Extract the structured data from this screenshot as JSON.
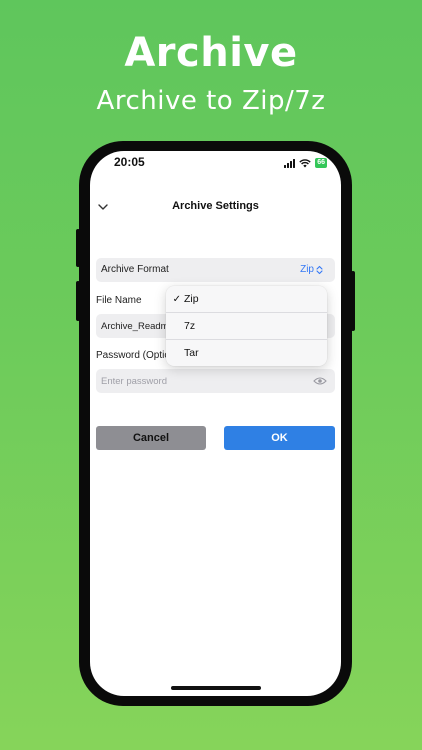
{
  "promo": {
    "title": "Archive",
    "subtitle": "Archive to Zip/7z"
  },
  "status_bar": {
    "time": "20:05",
    "battery": "66"
  },
  "nav": {
    "title": "Archive Settings",
    "back_icon": "chevron-down-icon"
  },
  "form": {
    "format": {
      "label": "Archive Format",
      "value": "Zip"
    },
    "file_name": {
      "label": "File Name",
      "value": "Archive_Readme"
    },
    "password": {
      "label": "Password (Optional)",
      "placeholder": "Enter password",
      "icon": "eye-icon"
    }
  },
  "dropdown": {
    "options": [
      "Zip",
      "7z",
      "Tar"
    ],
    "selected": "Zip",
    "check": "✓"
  },
  "buttons": {
    "cancel": "Cancel",
    "ok": "OK"
  },
  "colors": {
    "accent": "#2f80e4",
    "background": "#6dcb5b",
    "cancel": "#8e8e93"
  }
}
